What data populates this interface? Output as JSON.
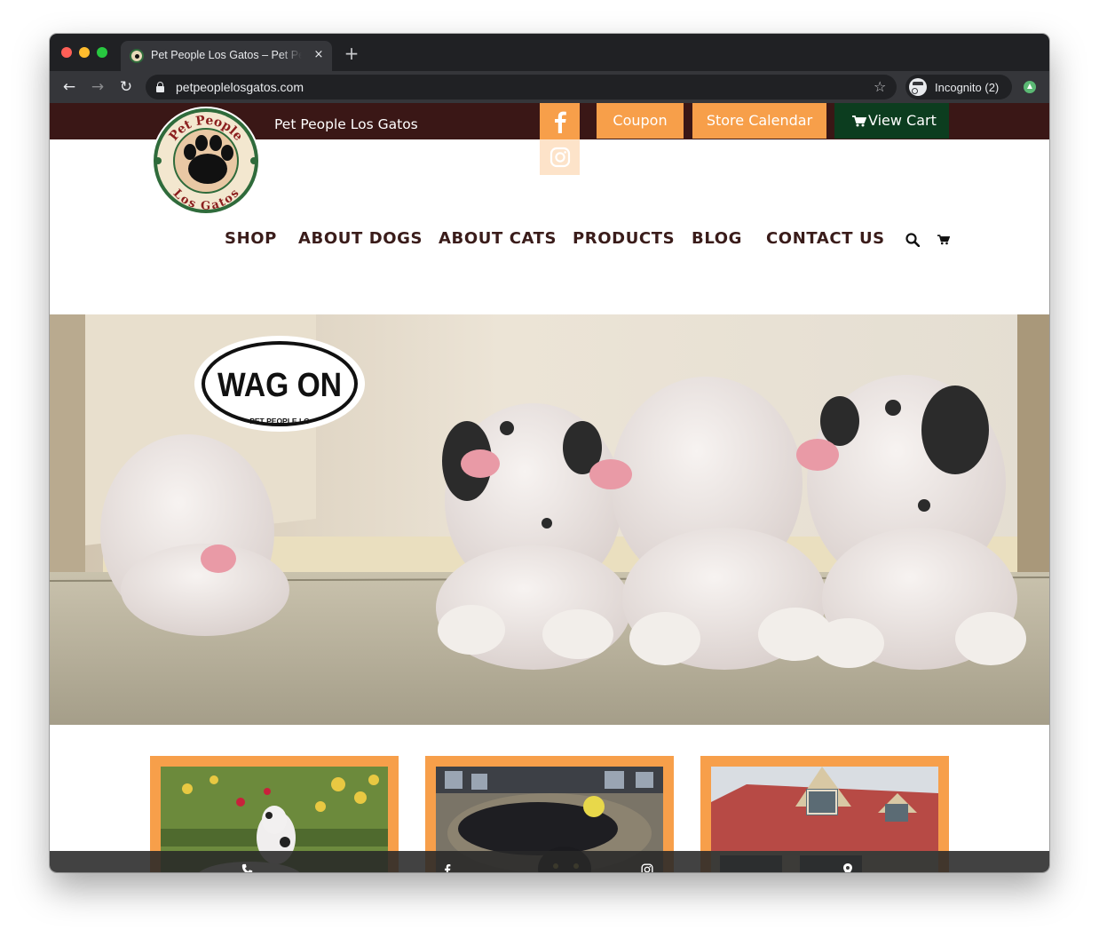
{
  "browser": {
    "tab_title": "Pet People Los Gatos – Pet People Los Gatos",
    "tab_close": "×",
    "new_tab": "+",
    "url": "petpeoplelosgatos.com",
    "incognito_label": "Incognito (2)",
    "back": "←",
    "forward": "→",
    "reload": "↻",
    "bookmark_star": "☆"
  },
  "header": {
    "site_title": "Pet People Los Gatos",
    "logo_text_top": "Pet People",
    "logo_text_bottom": "Los Gatos",
    "buttons": {
      "coupon": "Coupon",
      "store_calendar": "Store Calendar",
      "view_cart": "View Cart"
    },
    "social_icons": [
      "facebook-icon",
      "instagram-icon"
    ]
  },
  "nav": {
    "items": [
      "SHOP",
      "ABOUT DOGS",
      "ABOUT CATS",
      "PRODUCTS",
      "BLOG",
      "CONTACT US"
    ]
  },
  "hero": {
    "badge_text": "WAG ON",
    "badge_subtext": "PET PEOPLE LG",
    "image_subject": "four puppies leaning over a wooden box"
  },
  "cards": [
    {
      "image": "dog-in-garden"
    },
    {
      "image": "black-cat-on-bed"
    },
    {
      "image": "storefront"
    }
  ],
  "bottom_bar": {
    "icons": [
      "phone-icon",
      "facebook-icon",
      "instagram-icon",
      "map-pin-icon"
    ]
  },
  "colors": {
    "topbar": "#3a1716",
    "accent_orange": "#f79f4a",
    "cart_green": "#0c3d1f",
    "nav_text": "#3a1c1a"
  }
}
